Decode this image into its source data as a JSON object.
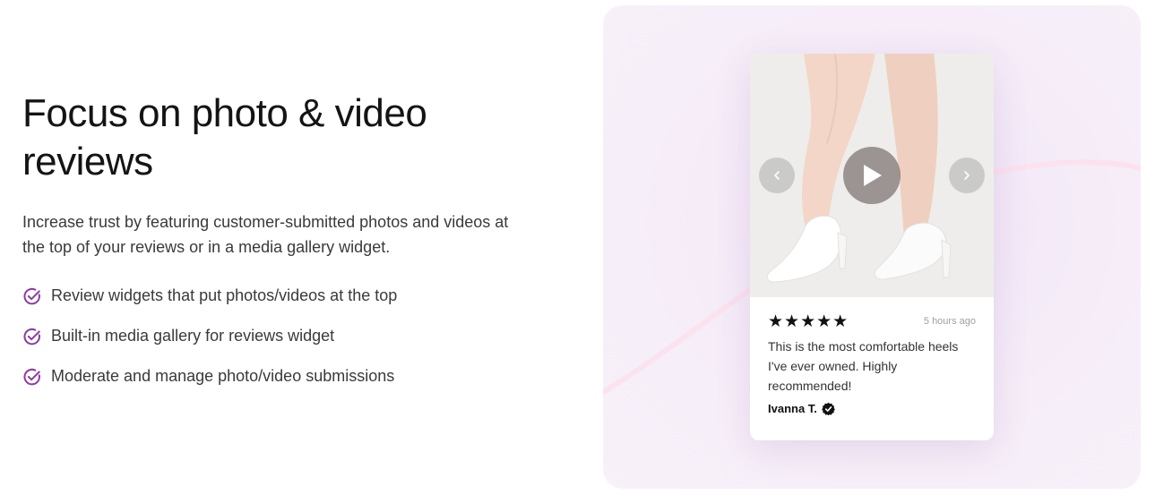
{
  "section": {
    "heading_line1": "Focus on photo & video",
    "heading_line2": "reviews",
    "description": "Increase trust by featuring customer-submitted photos and videos at the top of your reviews or in a media gallery widget.",
    "features": [
      "Review widgets that put photos/videos at the top",
      "Built-in media gallery for reviews widget",
      "Moderate and manage photo/video submissions"
    ],
    "check_icon": "check-circle-icon",
    "accent_color": "#8a3fa0"
  },
  "review_card": {
    "stars": "★★★★★",
    "rating": 5,
    "timestamp": "5 hours ago",
    "text": "This is the most comfortable heels I've ever owned. Highly recommended!",
    "author": "Ivanna T.",
    "verified_icon": "verified-badge-icon",
    "media_icons": [
      "chevron-left-icon",
      "play-icon",
      "chevron-right-icon"
    ]
  },
  "colors": {
    "panel_background": "#f5ecf8",
    "card_background": "#ffffff"
  }
}
